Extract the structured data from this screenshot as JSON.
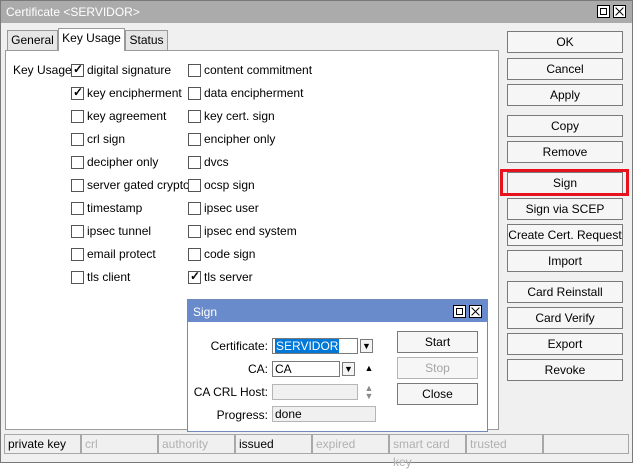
{
  "window": {
    "title": "Certificate <SERVIDOR>"
  },
  "tabs": [
    {
      "label": "General"
    },
    {
      "label": "Key Usage"
    },
    {
      "label": "Status"
    }
  ],
  "key_usage": {
    "label": "Key Usage:",
    "left": [
      {
        "label": "digital signature",
        "checked": true
      },
      {
        "label": "key encipherment",
        "checked": true
      },
      {
        "label": "key agreement",
        "checked": false
      },
      {
        "label": "crl sign",
        "checked": false
      },
      {
        "label": "decipher only",
        "checked": false
      },
      {
        "label": "server gated crypto",
        "checked": false
      },
      {
        "label": "timestamp",
        "checked": false
      },
      {
        "label": "ipsec tunnel",
        "checked": false
      },
      {
        "label": "email protect",
        "checked": false
      },
      {
        "label": "tls client",
        "checked": false
      }
    ],
    "right": [
      {
        "label": "content commitment",
        "checked": false
      },
      {
        "label": "data encipherment",
        "checked": false
      },
      {
        "label": "key cert. sign",
        "checked": false
      },
      {
        "label": "encipher only",
        "checked": false
      },
      {
        "label": "dvcs",
        "checked": false
      },
      {
        "label": "ocsp sign",
        "checked": false
      },
      {
        "label": "ipsec user",
        "checked": false
      },
      {
        "label": "ipsec end system",
        "checked": false
      },
      {
        "label": "code sign",
        "checked": false
      },
      {
        "label": "tls server",
        "checked": true
      }
    ]
  },
  "buttons": {
    "ok": "OK",
    "cancel": "Cancel",
    "apply": "Apply",
    "copy": "Copy",
    "remove": "Remove",
    "sign": "Sign",
    "sign_scep": "Sign via SCEP",
    "create_request": "Create Cert. Request",
    "import": "Import",
    "card_reinstall": "Card Reinstall",
    "card_verify": "Card Verify",
    "export": "Export",
    "revoke": "Revoke"
  },
  "statusbar": [
    {
      "label": "private key",
      "active": true
    },
    {
      "label": "crl",
      "active": false
    },
    {
      "label": "authority",
      "active": false
    },
    {
      "label": "issued",
      "active": true
    },
    {
      "label": "expired",
      "active": false
    },
    {
      "label": "smart card key",
      "active": false
    },
    {
      "label": "trusted",
      "active": false
    },
    {
      "label": "",
      "active": false
    }
  ],
  "sign_dialog": {
    "title": "Sign",
    "certificate_label": "Certificate:",
    "certificate_value": "SERVIDOR",
    "ca_label": "CA:",
    "ca_value": "CA",
    "ca_crl_host_label": "CA CRL Host:",
    "ca_crl_host_value": "",
    "progress_label": "Progress:",
    "progress_value": "done",
    "start": "Start",
    "stop": "Stop",
    "close": "Close"
  }
}
